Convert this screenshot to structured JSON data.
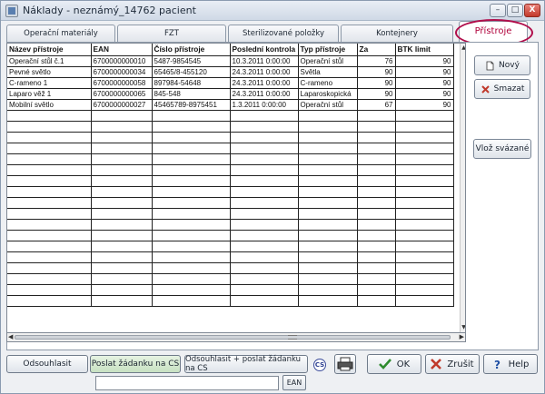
{
  "window": {
    "title": "Náklady - neznámý_14762 pacient",
    "minimize_label": "–",
    "maximize_label": "□",
    "close_label": "X"
  },
  "tabs": [
    {
      "label": "Operační materiály",
      "active": false
    },
    {
      "label": "FZT",
      "active": false
    },
    {
      "label": "Sterilizované položky",
      "active": false
    },
    {
      "label": "Kontejnery",
      "active": false
    },
    {
      "label": "Přístroje",
      "active": true
    }
  ],
  "grid": {
    "columns": [
      "Název přístroje",
      "EAN",
      "Číslo přístroje",
      "Poslední kontrola",
      "Typ přístroje",
      "Za",
      "BTK limit"
    ],
    "rows": [
      [
        "Operační stůl č.1",
        "6700000000010",
        "5487-9854545",
        "10.3.2011 0:00:00",
        "Operační stůl",
        "76",
        "90"
      ],
      [
        "Pevné světlo",
        "6700000000034",
        "65465/8-455120",
        "24.3.2011 0:00:00",
        "Světla",
        "90",
        "90"
      ],
      [
        "C-rameno 1",
        "6700000000058",
        "897984-54648",
        "24.3.2011 0:00:00",
        "C-rameno",
        "90",
        "90"
      ],
      [
        "Laparo věž 1",
        "6700000000065",
        "845-548",
        "24.3.2011 0:00:00",
        "Laparoskopická",
        "90",
        "90"
      ],
      [
        "Mobilní světlo",
        "6700000000027",
        "45465789-8975451",
        "1.3.2011 0:00:00",
        "Operační stůl",
        "67",
        "90"
      ]
    ]
  },
  "side_buttons": {
    "new_label": "Nový",
    "delete_label": "Smazat",
    "insert_linked_label": "Vlož svázané"
  },
  "bottom": {
    "approve_label": "Odsouhlasit",
    "send_request_label": "Poslat žádanku na CS",
    "approve_send_label": "Odsouhlasit + poslat žádanku na CS",
    "ok_label": "OK",
    "cancel_label": "Zrušit",
    "help_label": "Help",
    "ean_input_value": "",
    "ean_button_label": "EAN",
    "round_icon_text": "CS"
  },
  "colors": {
    "active_tab_text": "#b0003a",
    "highlight_ring": "#b00d4a",
    "ok_check": "#2e8b2e",
    "cancel_x": "#c0392b",
    "help_question": "#1f4fa3"
  }
}
